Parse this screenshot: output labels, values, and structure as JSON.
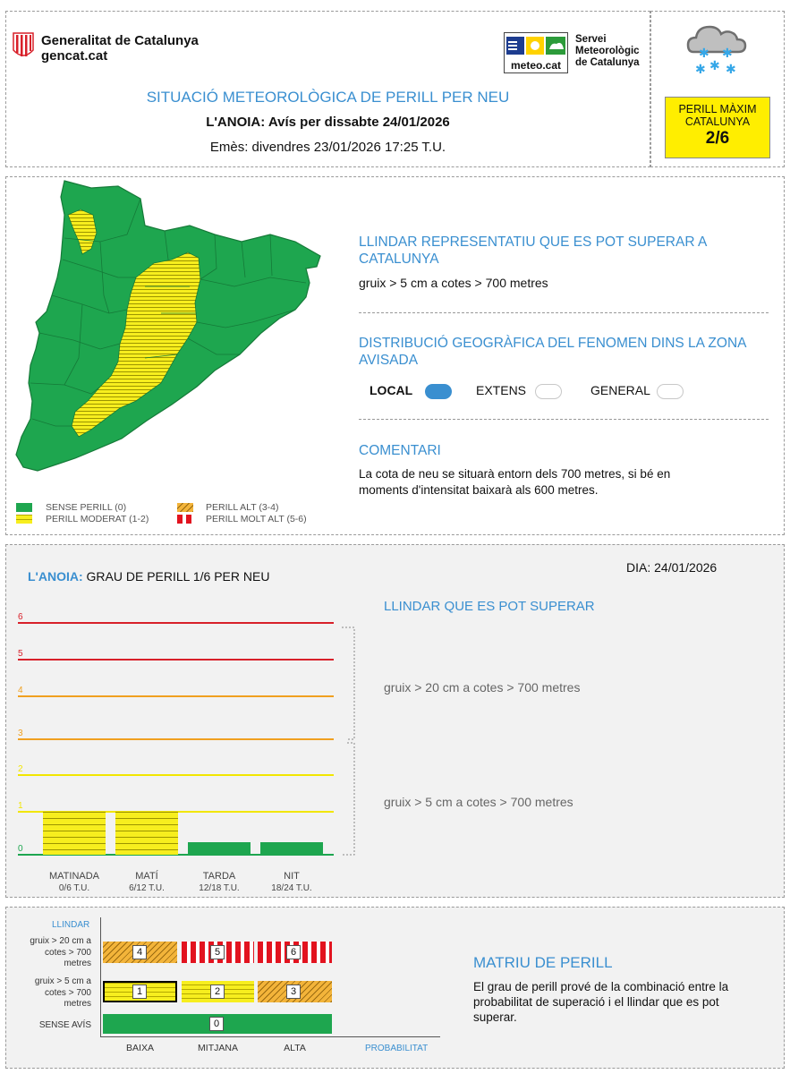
{
  "header": {
    "gencat_line1": "Generalitat de Catalunya",
    "gencat_line2": "gencat.cat",
    "meteo_logo_text": "meteo.cat",
    "smc_line1": "Servei",
    "smc_line2": "Meteorològic",
    "smc_line3": "de Catalunya",
    "title": "SITUACIÓ METEOROLÒGICA DE PERILL PER NEU",
    "subtitle": "L'ANOIA: Avís per dissabte 24/01/2026",
    "issued": "Emès: divendres 23/01/2026 17:25 T.U.",
    "max_label_1": "PERILL MÀXIM",
    "max_label_2": "CATALUNYA",
    "max_value": "2/6",
    "weather_icon": "snow-cloud-icon"
  },
  "map_section": {
    "legend": [
      {
        "label": "SENSE PERILL (0)",
        "style": "green"
      },
      {
        "label": "PERILL MODERAT (1-2)",
        "style": "yellow"
      },
      {
        "label": "PERILL ALT (3-4)",
        "style": "orange"
      },
      {
        "label": "PERILL MOLT ALT (5-6)",
        "style": "red"
      }
    ],
    "threshold_title": "LLINDAR REPRESENTATIU QUE ES POT SUPERAR A CATALUNYA",
    "threshold_text": "gruix > 5 cm a cotes > 700 metres",
    "distribution_title": "DISTRIBUCIÓ GEOGRÀFICA DEL FENOMEN DINS LA ZONA AVISADA",
    "distribution_options": [
      {
        "label": "LOCAL",
        "selected": true
      },
      {
        "label": "EXTENS",
        "selected": false
      },
      {
        "label": "GENERAL",
        "selected": false
      }
    ],
    "comment_title": "COMENTARI",
    "comment_text": "La cota de neu se situarà entorn dels 700 metres, si bé en moments d'intensitat baixarà als 600 metres."
  },
  "chart_section": {
    "title_region": "L'ANOIA:",
    "title_rest": "GRAU DE PERILL 1/6 PER NEU",
    "date": "DIA: 24/01/2026",
    "threshold_heading": "LLINDAR QUE ES POT SUPERAR",
    "threshold_upper": "gruix > 20 cm a cotes > 700 metres",
    "threshold_lower": "gruix > 5 cm a cotes > 700 metres"
  },
  "chart_data": {
    "type": "bar",
    "categories": [
      "MATINADA",
      "MATÍ",
      "TARDA",
      "NIT"
    ],
    "category_sublabels": [
      "0/6 T.U.",
      "6/12 T.U.",
      "12/18 T.U.",
      "18/24 T.U."
    ],
    "values": [
      1,
      1,
      0,
      0
    ],
    "ylim": [
      0,
      6
    ],
    "y_ticks": [
      "0",
      "1",
      "2",
      "3",
      "4",
      "5",
      "6"
    ],
    "level_colors": {
      "0": "#1ea64f",
      "1": "#f2e600",
      "2": "#f2e600",
      "3": "#f0a020",
      "4": "#f0a020",
      "5": "#d8202a",
      "6": "#d8202a"
    }
  },
  "matrix_section": {
    "axis_y_label": "LLINDAR",
    "row_labels": [
      "gruix > 20 cm a cotes > 700 metres",
      "gruix > 5 cm a cotes > 700 metres",
      "SENSE AVÍS"
    ],
    "col_labels": [
      "BAIXA",
      "MITJANA",
      "ALTA"
    ],
    "axis_x_label": "PROBABILITAT",
    "cells_row1": [
      "4",
      "5",
      "6"
    ],
    "cells_row2": [
      "1",
      "2",
      "3"
    ],
    "cell_row3": "0",
    "selected_cell": "1",
    "title": "MATRIU DE PERILL",
    "text": "El grau de perill prové de la combinació entre la probabilitat de superació i el llindar que es pot superar."
  }
}
